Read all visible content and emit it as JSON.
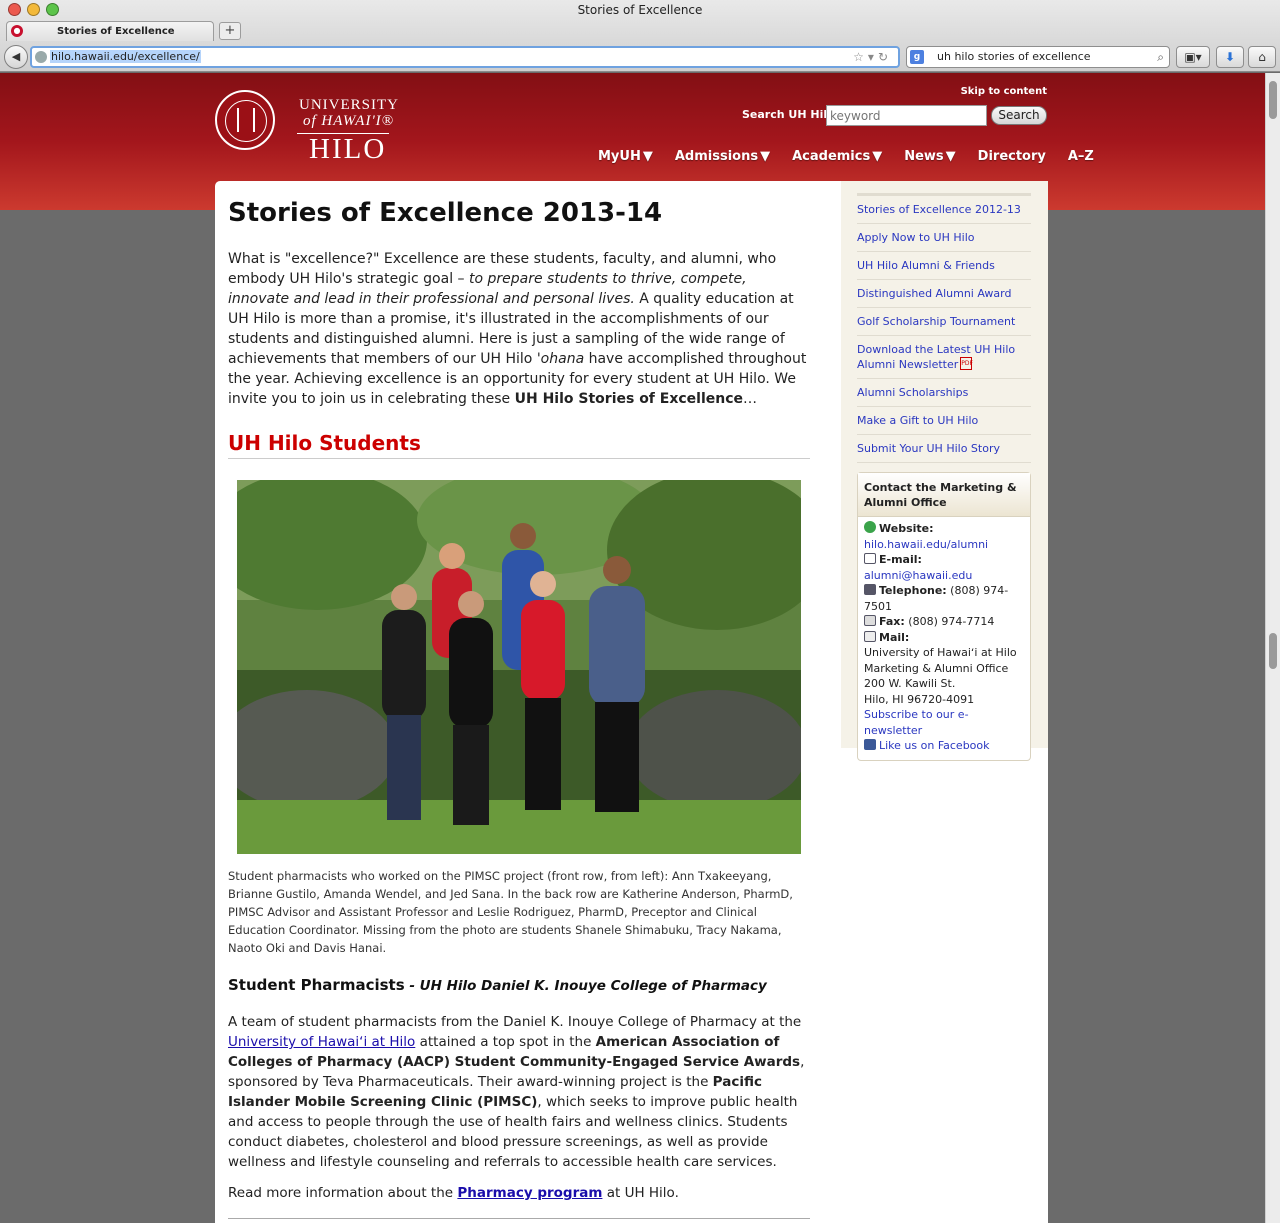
{
  "browser": {
    "window_title": "Stories of Excellence",
    "tab_title": "Stories of Excellence",
    "new_tab_label": "+",
    "url": "hilo.hawaii.edu/excellence/",
    "search_query": "uh hilo stories of excellence"
  },
  "header": {
    "logo_line1": "UNIVERSITY",
    "logo_line2": "of HAWAI'I®",
    "logo_line3": "HILO",
    "skip_link": "Skip to content",
    "search_label": "Search UH Hilo:",
    "search_placeholder": "keyword",
    "search_button": "Search",
    "nav": [
      "MyUH",
      "Admissions",
      "Academics",
      "News",
      "Directory",
      "A–Z"
    ]
  },
  "main": {
    "title": "Stories of Excellence 2013-14",
    "intro": {
      "p1": "What is \"excellence?\" Excellence are these students, faculty, and alumni, who embody UH Hilo's strategic goal – ",
      "p1_em": "to prepare students to thrive, compete, innovate and lead in their professional and personal lives.",
      "p2": " A quality education at UH Hilo is more than a promise, it's illustrated in the accomplishments of our students and distinguished alumni. Here is just a sampling of the wide range of achievements that members of our UH Hilo ",
      "p2_em": "'ohana",
      "p3": " have accomplished throughout the year. Achieving excellence is an opportunity for every student at UH Hilo. We invite you to join us in celebrating these ",
      "p3_bold": "UH Hilo Stories of Excellence",
      "p3_end": "…"
    },
    "section_heading": "UH Hilo Students",
    "photo_caption": "Student pharmacists who worked on the PIMSC project (front row, from left): Ann Txakeeyang, Brianne Gustilo, Amanda Wendel, and Jed Sana. In the back row are Katherine Anderson, PharmD, PIMSC Advisor and Assistant Professor and Leslie Rodriguez, PharmD, Preceptor and Clinical Education Coordinator. Missing from the photo are students Shanele Shimabuku, Tracy Nakama, Naoto Oki and Davis Hanai.",
    "story_heading": "Student Pharmacists",
    "story_subheading": " - UH Hilo Daniel K. Inouye College of Pharmacy",
    "story": {
      "t1": "A team of student pharmacists from the Daniel K. Inouye College of Pharmacy at the ",
      "link1": "University of Hawaiʻi at Hilo",
      "t2": " attained a top spot in the ",
      "b1": "American Association of Colleges of Pharmacy (AACP) Student Community-Engaged Service Awards",
      "t3": ", sponsored by Teva Pharmaceuticals. Their award-winning project is the ",
      "b2": "Pacific Islander Mobile Screening Clinic (PIMSC)",
      "t4": ", which seeks to improve public health and access to people through the use of health fairs and wellness clinics. Students conduct diabetes, cholesterol and blood pressure screenings, as well as provide wellness and lifestyle counseling and referrals to accessible health care services."
    },
    "read_more_pre": "Read more information about the ",
    "read_more_link": "Pharmacy program",
    "read_more_post": " at UH Hilo."
  },
  "sidebar": {
    "links": [
      "Stories of Excellence 2012-13",
      "Apply Now to UH Hilo",
      "UH Hilo Alumni & Friends",
      "Distinguished Alumni Award",
      "Golf Scholarship Tournament",
      "Download the Latest UH Hilo Alumni Newsletter",
      "Alumni Scholarships",
      "Make a Gift to UH Hilo",
      "Submit Your UH Hilo Story"
    ],
    "contact": {
      "heading": "Contact the Marketing & Alumni Office",
      "website_label": "Website:",
      "website": "hilo.hawaii.edu/alumni",
      "email_label": "E-mail:",
      "email": "alumni@hawaii.edu",
      "tel_label": "Telephone:",
      "tel": " (808) 974-7501",
      "fax_label": "Fax:",
      "fax": " (808) 974-7714",
      "mail_label": "Mail:",
      "addr1": "University of Hawaiʻi at Hilo",
      "addr2": "Marketing & Alumni Office",
      "addr3": "200 W. Kawili St.",
      "addr4": "Hilo, HI 96720-4091",
      "newsletter_link": "Subscribe to our e-newsletter",
      "facebook_link": "Like us on Facebook"
    }
  }
}
